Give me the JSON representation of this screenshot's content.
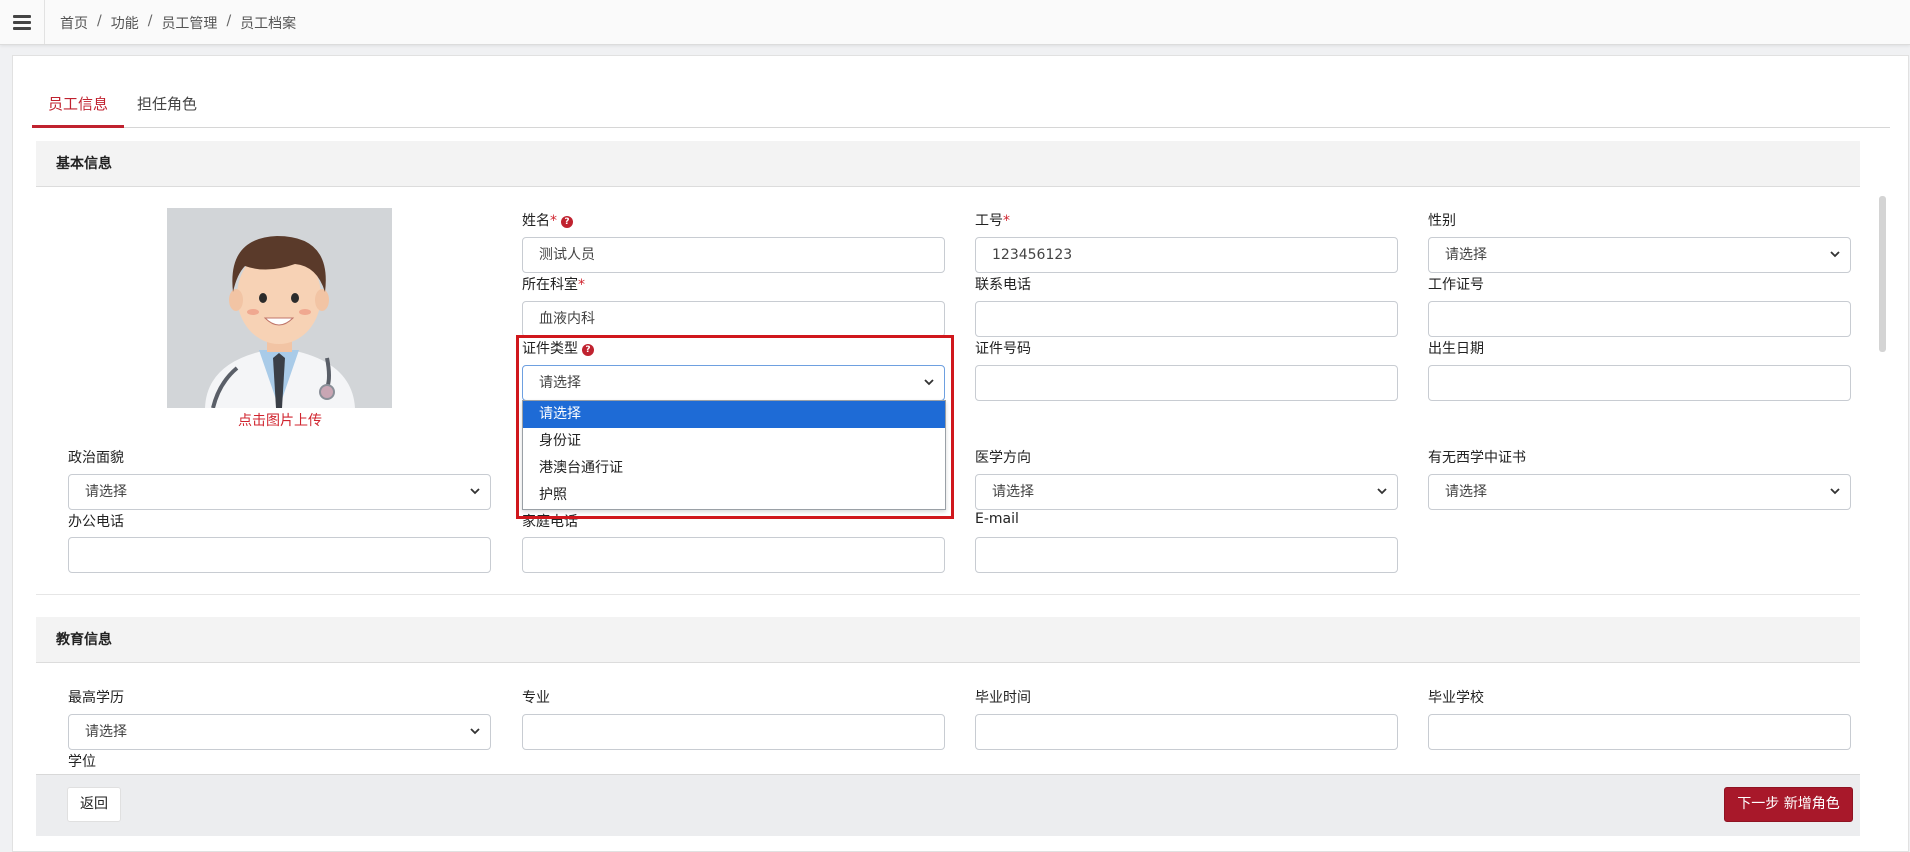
{
  "breadcrumb": [
    "首页",
    "功能",
    "员工管理",
    "员工档案"
  ],
  "tabs": [
    {
      "label": "员工信息",
      "active": true
    },
    {
      "label": "担任角色",
      "active": false
    }
  ],
  "sections": {
    "basic": "基本信息",
    "education": "教育信息"
  },
  "photo": {
    "upload_label": "点击图片上传"
  },
  "fields": {
    "name": {
      "label": "姓名",
      "value": "测试人员"
    },
    "employee_no": {
      "label": "工号",
      "value": "123456123"
    },
    "gender": {
      "label": "性别",
      "value": "请选择"
    },
    "department": {
      "label": "所在科室",
      "value": "血液内科"
    },
    "phone": {
      "label": "联系电话",
      "value": ""
    },
    "work_id": {
      "label": "工作证号",
      "value": ""
    },
    "id_type": {
      "label": "证件类型",
      "value": "请选择"
    },
    "id_number": {
      "label": "证件号码",
      "value": ""
    },
    "birth_date": {
      "label": "出生日期",
      "value": ""
    },
    "political": {
      "label": "政治面貌",
      "value": "请选择"
    },
    "medical_direction": {
      "label": "医学方向",
      "value": "请选择"
    },
    "tcm_cert": {
      "label": "有无西学中证书",
      "value": "请选择"
    },
    "office_phone": {
      "label": "办公电话",
      "value": ""
    },
    "home_phone": {
      "label": "家庭电话",
      "value": ""
    },
    "email": {
      "label": "E-mail",
      "value": ""
    },
    "education": {
      "label": "最高学历",
      "value": "请选择"
    },
    "major": {
      "label": "专业",
      "value": ""
    },
    "grad_time": {
      "label": "毕业时间",
      "value": ""
    },
    "school": {
      "label": "毕业学校",
      "value": ""
    },
    "degree": {
      "label": "学位"
    }
  },
  "id_type_options": [
    "请选择",
    "身份证",
    "港澳台通行证",
    "护照"
  ],
  "buttons": {
    "back": "返回",
    "next": "下一步 新增角色"
  },
  "colors": {
    "accent": "#c0222f",
    "button": "#a8182a",
    "selected_option": "#1e6bd6"
  }
}
